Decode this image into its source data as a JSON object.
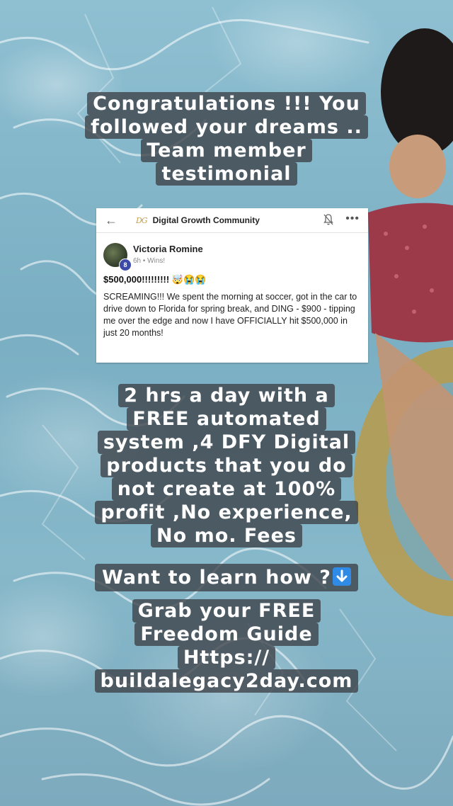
{
  "headline": {
    "lines": [
      "Congratulations !!! You",
      "followed your dreams ..",
      "Team member",
      "testimonial"
    ]
  },
  "post": {
    "group_name": "Digital Growth Community",
    "logo_text": "DG",
    "author_name": "Victoria Romine",
    "author_level": "8",
    "meta": "6h • Wins!",
    "title": "$500,000!!!!!!!!! 🤯😭😭",
    "body": "SCREAMING!!! We spent the morning at soccer, got in the car to drive down to Florida for spring break, and DING - $900 - tipping me over the edge and now I have OFFICIALLY hit $500,000 in just 20 months!"
  },
  "pitch": {
    "lines": [
      "2 hrs a day with a",
      "FREE automated",
      "system ,4 DFY Digital",
      "products that you do",
      "not create at 100%",
      "profit ,No experience,",
      "No mo. Fees"
    ]
  },
  "cta": {
    "text": "Want to learn how ?",
    "icon": "down-arrow-icon"
  },
  "guide": {
    "lines": [
      "Grab your FREE",
      "Freedom Guide",
      "Https://",
      "buildalegacy2day.com"
    ]
  }
}
